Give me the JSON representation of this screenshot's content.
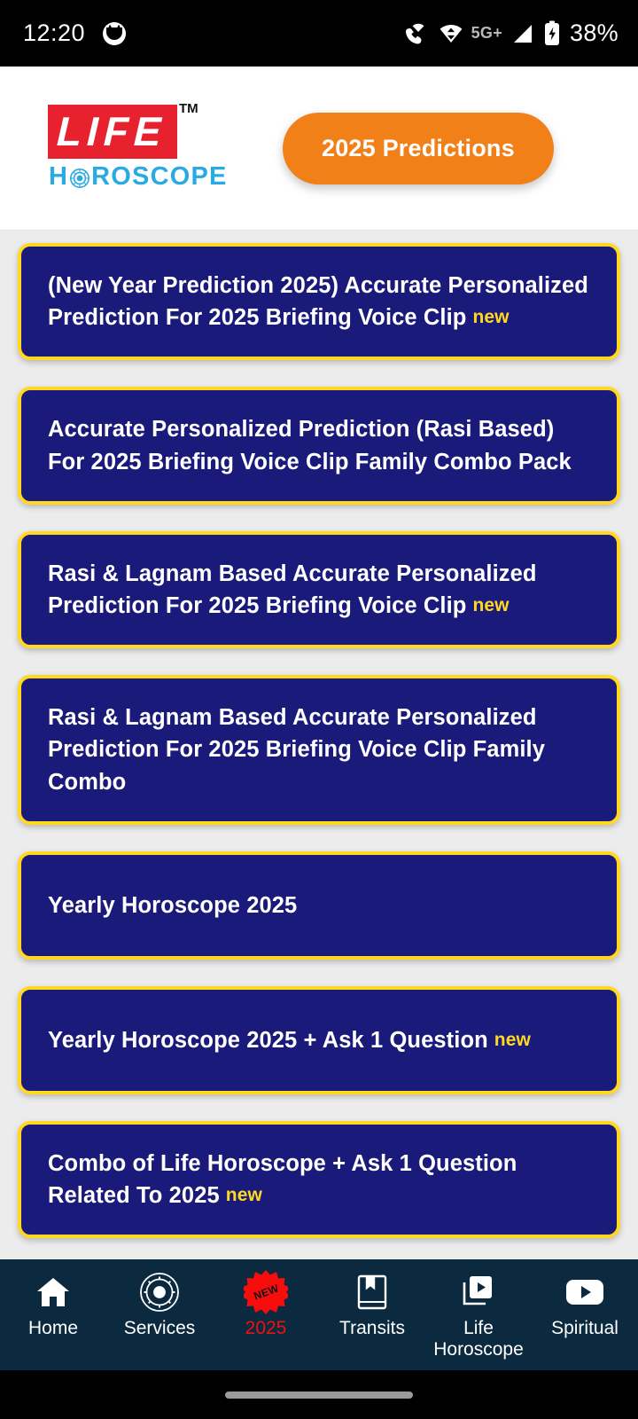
{
  "status_bar": {
    "time": "12:20",
    "app_icon": "app-notification-icon",
    "icons": [
      "wifi-calling-icon",
      "wifi-icon",
      "signal-icon",
      "battery-charging-icon"
    ],
    "network": "5G+",
    "battery": "38%"
  },
  "header": {
    "logo": {
      "primary": "LIFE",
      "trademark": "TM",
      "secondary_pre": "H",
      "secondary_post": "ROSCOPE",
      "zodiac_icon": "zodiac-wheel-icon",
      "primary_bg": "#e8212e",
      "secondary_color": "#29abe2"
    },
    "predictions_button": {
      "label": "2025 Predictions",
      "color": "#f28018"
    }
  },
  "cards": [
    {
      "title": "(New Year Prediction 2025) Accurate Personalized Prediction For 2025 Briefing Voice Clip",
      "badge": "new"
    },
    {
      "title": "Accurate Personalized Prediction (Rasi Based) For 2025 Briefing Voice Clip Family Combo Pack",
      "badge": ""
    },
    {
      "title": "Rasi & Lagnam Based Accurate Personalized Prediction For 2025 Briefing Voice Clip",
      "badge": "new"
    },
    {
      "title": "Rasi & Lagnam Based Accurate Personalized Prediction For 2025 Briefing Voice Clip Family Combo",
      "badge": ""
    },
    {
      "title": "Yearly Horoscope 2025",
      "badge": ""
    },
    {
      "title": "Yearly Horoscope 2025 + Ask 1 Question",
      "badge": "new"
    },
    {
      "title": "Combo of Life Horoscope + Ask 1 Question Related To 2025",
      "badge": "new"
    },
    {
      "title": "",
      "badge": ""
    }
  ],
  "card_style": {
    "background": "#1a1a7a",
    "border": "#ffd81f",
    "badge_color": "#ffd81f"
  },
  "bottom_nav": {
    "background": "#0b2a40",
    "active_color": "#f01010",
    "items": [
      {
        "label": "Home",
        "icon": "home-icon",
        "active": false
      },
      {
        "label": "Services",
        "icon": "zodiac-wheel-icon",
        "active": false
      },
      {
        "label": "2025",
        "icon": "new-starburst-icon",
        "badge": "NEW",
        "active": true
      },
      {
        "label": "Transits",
        "icon": "book-icon",
        "active": false
      },
      {
        "label": "Life Horoscope",
        "icon": "video-library-icon",
        "active": false
      },
      {
        "label": "Spiritual",
        "icon": "youtube-play-icon",
        "active": false
      }
    ]
  }
}
